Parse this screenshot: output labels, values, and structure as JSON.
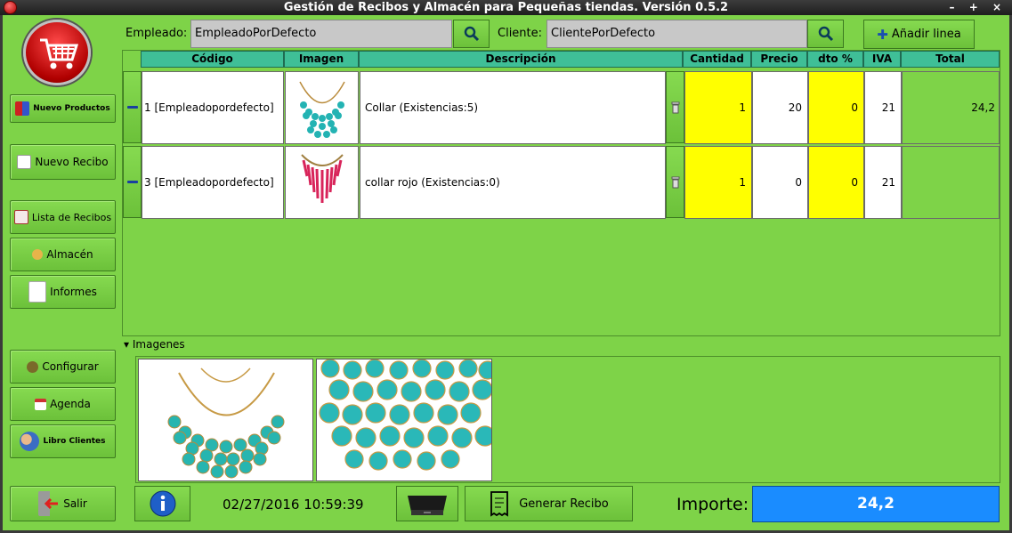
{
  "window": {
    "title": "Gestión de Recibos y Almacén para Pequeñas tiendas. Versión 0.5.2",
    "controls": "– + ×"
  },
  "sidebar": {
    "items": [
      {
        "label": "Nuevo Productos",
        "icon": "clothes-icon"
      },
      {
        "label": "Nuevo Recibo",
        "icon": "new-document-icon"
      },
      {
        "label": "Lista de Recibos",
        "icon": "receipt-list-icon"
      },
      {
        "label": "Almacén",
        "icon": "warehouse-icon"
      },
      {
        "label": "Informes",
        "icon": "reports-icon"
      },
      {
        "label": "Configurar",
        "icon": "settings-icon"
      },
      {
        "label": "Agenda",
        "icon": "calendar-icon"
      },
      {
        "label": "Libro Clientes",
        "icon": "clients-icon"
      },
      {
        "label": "Salir",
        "icon": "exit-icon"
      }
    ]
  },
  "header": {
    "employee_label": "Empleado:",
    "employee_value": "EmpleadoPorDefecto",
    "client_label": "Cliente:",
    "client_value": "ClientePorDefecto",
    "add_line_label": "Añadir linea"
  },
  "table": {
    "columns": [
      "Código",
      "Imagen",
      "Descripción",
      "Cantidad",
      "Precio",
      "dto %",
      "IVA",
      "Total"
    ],
    "rows": [
      {
        "code": "1 [Empleadopordefecto]",
        "image": "turquoise-necklace-image",
        "description": "Collar (Existencias:5)",
        "quantity": "1",
        "price": "20",
        "discount": "0",
        "iva": "21",
        "total": "24,2"
      },
      {
        "code": "3 [Empleadopordefecto]",
        "image": "red-necklace-image",
        "description": "collar rojo (Existencias:0)",
        "quantity": "1",
        "price": "0",
        "discount": "0",
        "iva": "21",
        "total": ""
      }
    ]
  },
  "images_section": {
    "label": "Imagenes"
  },
  "footer": {
    "datetime": "02/27/2016 10:59:39",
    "generate_label": "Generar Recibo",
    "total_label": "Importe:",
    "total_value": "24,2"
  },
  "colors": {
    "background": "#7ed348",
    "header": "#3fbf97",
    "editable_cell": "#ffff00",
    "total_box": "#1a8cff"
  }
}
